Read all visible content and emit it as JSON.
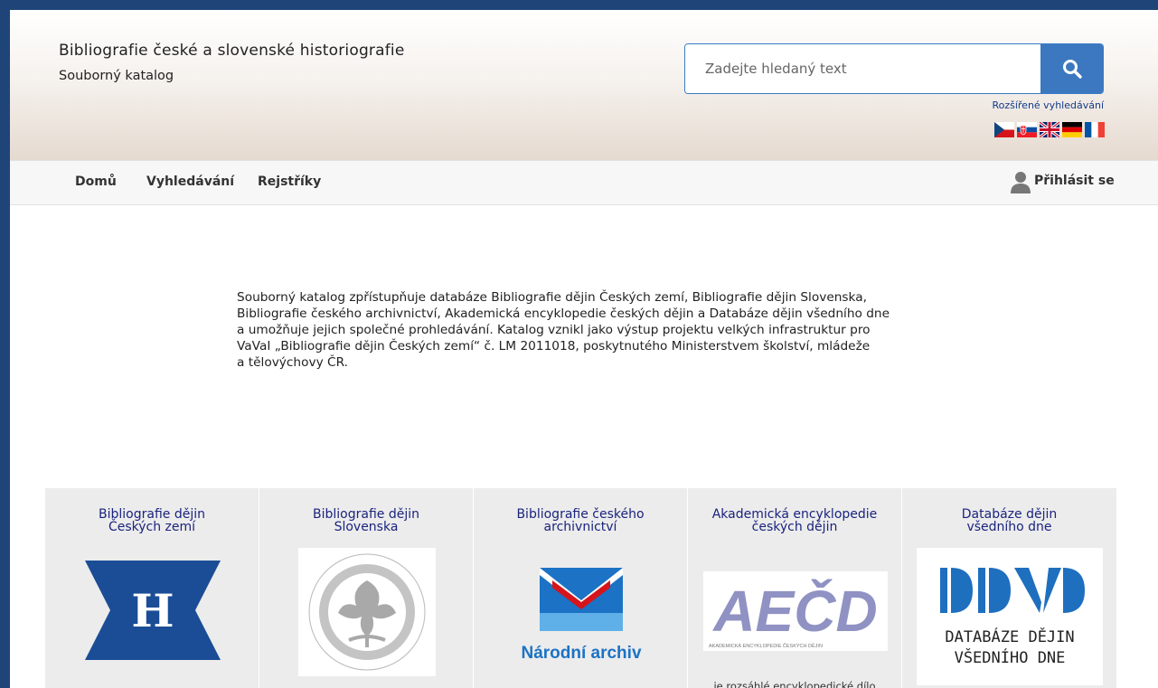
{
  "header": {
    "site_title": "Bibliografie české a slovenské historiografie",
    "site_subtitle": "Souborný katalog",
    "search_placeholder": "Zadejte hledaný text",
    "advanced_search_label": "Rozšířené vyhledávání",
    "languages": [
      "cs",
      "sk",
      "en",
      "de",
      "fr"
    ]
  },
  "nav": {
    "items": [
      {
        "label": "Domů"
      },
      {
        "label": "Vyhledávání"
      },
      {
        "label": "Rejstříky"
      }
    ],
    "login_label": "Přihlásit se"
  },
  "intro": {
    "lines": [
      "Souborný katalog zpřístupňuje databáze Bibliografie dějin Českých zemí, Bibliografie dějin Slovenska,",
      "Bibliografie českého archivnictví, Akademická encyklopedie českých dějin a  Databáze dějin všedního dne",
      "a umožňuje jejich společné prohledávání. Katalog vznikl jako výstup projektu velkých infrastruktur pro",
      "VaVaI „Bibliografie dějin Českých zemí“ č. LM 2011018, poskytnutého Ministerstvem školství, mládeže",
      "a tělovýchovy ČR."
    ]
  },
  "cards": [
    {
      "title_lines": [
        "Bibliografie dějin",
        "Českých zemí"
      ],
      "logo_text": "H"
    },
    {
      "title_lines": [
        "Bibliografie dějin",
        "Slovenska"
      ]
    },
    {
      "title_lines": [
        "Bibliografie českého",
        "archivnictví"
      ],
      "logo_text": "Národní archiv"
    },
    {
      "title_lines": [
        "Akademická encyklopedie",
        "českých dějin"
      ],
      "logo_text": "AEČD",
      "logo_caption": "AKADEMICKÁ ENCYKLOPEDIE ČESKÝCH DĚJIN",
      "text": "je rozsáhlé encyklopedické dílo"
    },
    {
      "title_lines": [
        "Databáze dějin",
        "všedního dne"
      ],
      "logo_text_lines": [
        "DATABÁZE DĚJIN",
        "VŠEDNÍHO DNE"
      ]
    }
  ],
  "colors": {
    "frame": "#1e4478",
    "accent": "#3b78bf",
    "card_bg": "#ececec",
    "card_title": "#1a237e"
  },
  "icons": {
    "search_button": "search-icon",
    "login": "user-icon"
  }
}
